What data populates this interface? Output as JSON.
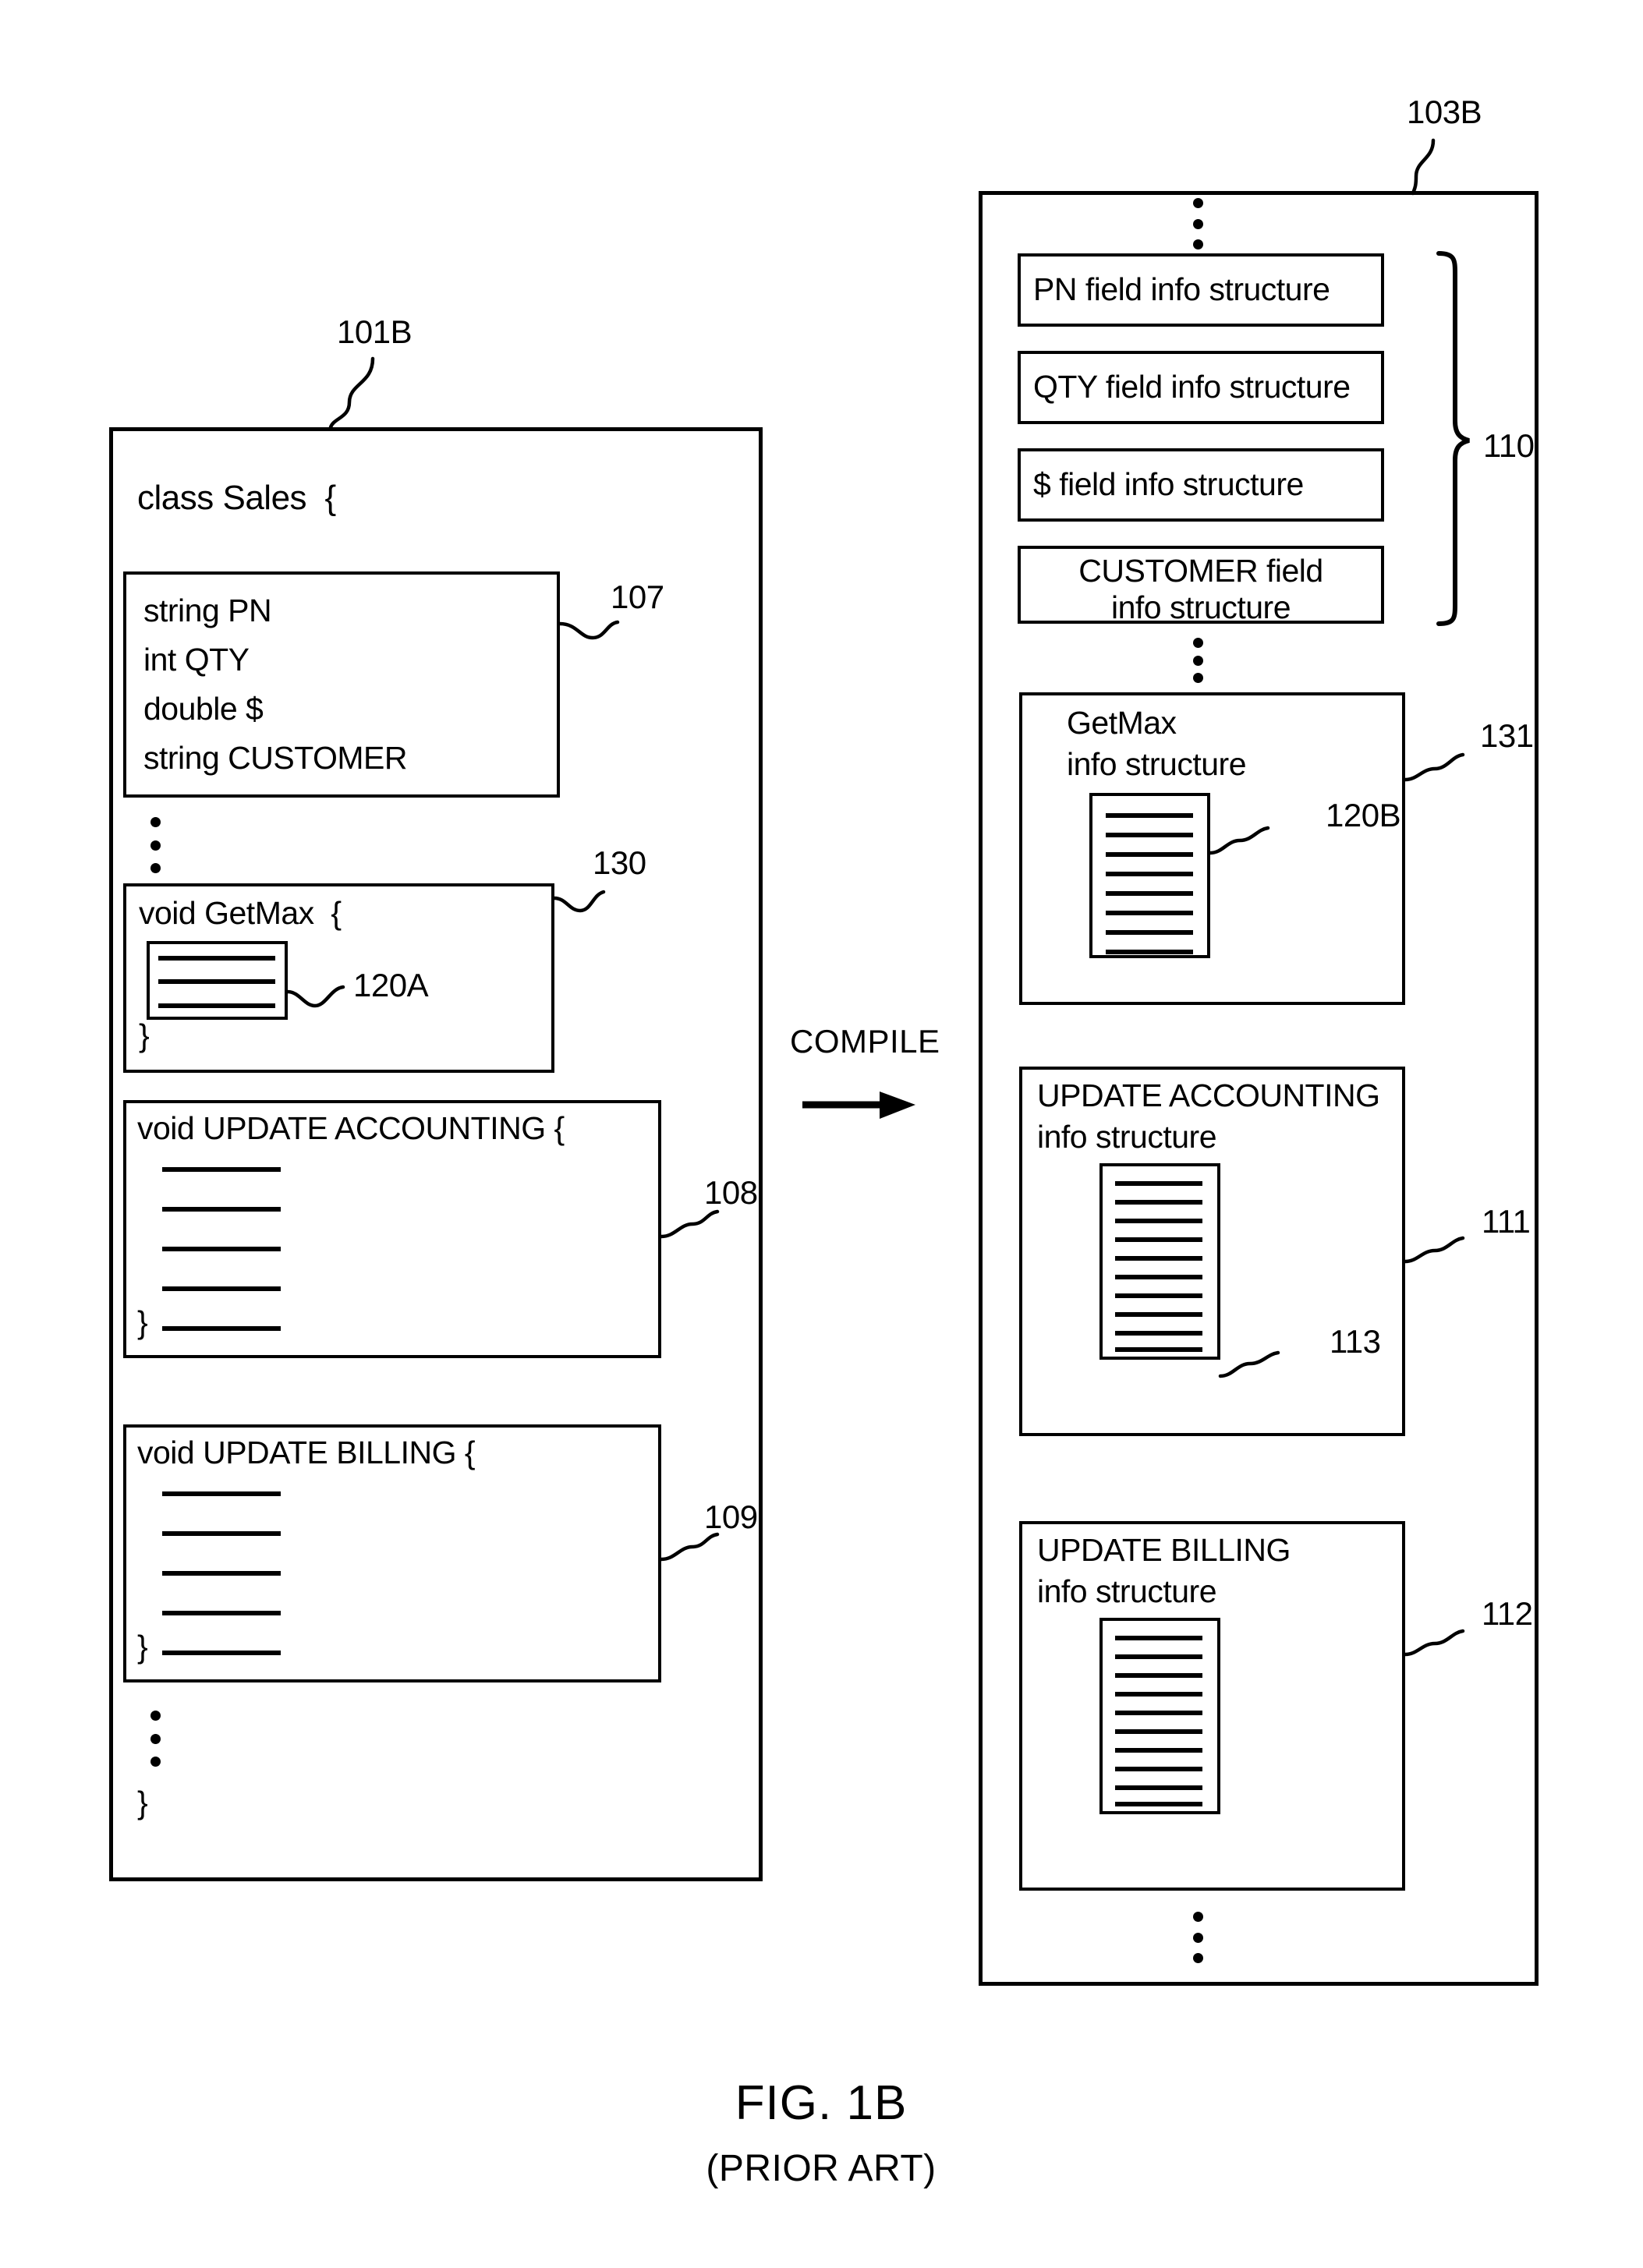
{
  "figure": {
    "caption": "FIG. 1B",
    "subcaption": "(PRIOR ART)"
  },
  "transform": {
    "label": "COMPILE",
    "arrow": "right-arrow"
  },
  "source_panel": {
    "ref": "101B",
    "class_header": "class Sales  {",
    "class_close": "}",
    "fields_block": {
      "ref": "107",
      "lines": [
        "string PN",
        "int QTY",
        "double $",
        "string CUSTOMER"
      ]
    },
    "ellipsis_after_fields": "⋮",
    "methods": [
      {
        "ref": "130",
        "header": "void GetMax  {",
        "close": "}",
        "body_ref": "120A",
        "body_line_count": 3
      },
      {
        "ref": "108",
        "header": "void UPDATE ACCOUNTING {",
        "close": "}",
        "body_ref": "",
        "body_line_count": 5
      },
      {
        "ref": "109",
        "header": "void UPDATE BILLING {",
        "close": "}",
        "body_ref": "",
        "body_line_count": 5
      }
    ],
    "ellipsis_before_close": "⋮"
  },
  "compiled_panel": {
    "ref": "103B",
    "ellipsis_top": "⋮",
    "ellipsis_mid": "⋮",
    "ellipsis_bottom": "⋮",
    "field_group": {
      "ref": "110",
      "brace": "right-curly-brace",
      "items": [
        {
          "label": "PN field info structure",
          "align": "left"
        },
        {
          "label": "QTY field info structure",
          "align": "left"
        },
        {
          "label": "$ field info structure",
          "align": "left"
        },
        {
          "label": "CUSTOMER field\ninfo structure",
          "align": "center"
        }
      ]
    },
    "method_structures": [
      {
        "ref": "131",
        "title_line1": "GetMax",
        "title_line2": "info structure",
        "title_indent": true,
        "body_ref": "120B",
        "body_line_count": 8
      },
      {
        "ref": "111",
        "title_line1": "UPDATE ACCOUNTING",
        "title_line2": "info structure",
        "title_indent": false,
        "body_ref": "113",
        "body_line_count": 10
      },
      {
        "ref": "112",
        "title_line1": "UPDATE BILLING",
        "title_line2": "info structure",
        "title_indent": false,
        "body_ref": "",
        "body_line_count": 10
      }
    ]
  }
}
